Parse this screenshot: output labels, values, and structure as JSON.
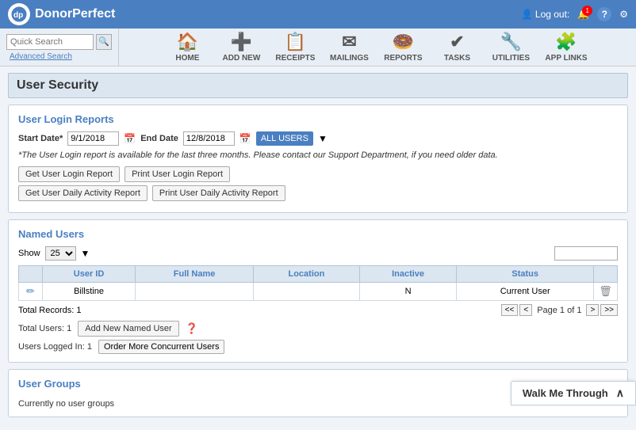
{
  "header": {
    "logo_initials": "dp",
    "logo_alt": "DonorPerfect",
    "logout_label": "Log out:",
    "notification_count": "1"
  },
  "search": {
    "placeholder": "Quick Search",
    "advanced_label": "Advanced Search"
  },
  "nav": {
    "items": [
      {
        "id": "home",
        "label": "HOME",
        "icon": "🏠"
      },
      {
        "id": "add-new",
        "label": "ADD NEW",
        "icon": "➕"
      },
      {
        "id": "receipts",
        "label": "RECEIPTS",
        "icon": "📋"
      },
      {
        "id": "mailings",
        "label": "MAILINGS",
        "icon": "✉"
      },
      {
        "id": "reports",
        "label": "REPORTS",
        "icon": "🍩"
      },
      {
        "id": "tasks",
        "label": "TASKS",
        "icon": "✔"
      },
      {
        "id": "utilities",
        "label": "UTILITIES",
        "icon": "🔧"
      },
      {
        "id": "app-links",
        "label": "APP LINKS",
        "icon": "🧩"
      }
    ]
  },
  "page": {
    "title": "User Security"
  },
  "login_reports": {
    "section_title": "User Login Reports",
    "start_date_label": "Start Date*",
    "start_date_value": "9/1/2018",
    "end_date_label": "End Date",
    "end_date_value": "12/8/2018",
    "all_users_label": "ALL USERS",
    "info_text": "*The User Login report is available for the last three months. Please contact our Support Department, if you need older data.",
    "btn_get_login": "Get User Login Report",
    "btn_print_login": "Print User Login Report",
    "btn_get_daily": "Get User Daily Activity Report",
    "btn_print_daily": "Print User Daily Activity Report"
  },
  "named_users": {
    "section_title": "Named Users",
    "show_label": "Show",
    "show_value": "25",
    "table_headers": [
      "User ID",
      "Full Name",
      "Location",
      "Inactive",
      "Status"
    ],
    "rows": [
      {
        "user_id": "Billstine",
        "full_name": "",
        "location": "",
        "inactive": "N",
        "status": "Current User"
      }
    ],
    "total_records_label": "Total Records: 1",
    "total_users_label": "Total Users: 1",
    "add_named_user_label": "Add New Named User",
    "users_logged_in_label": "Users Logged In: 1",
    "order_concurrent_label": "Order More Concurrent Users",
    "pagination": {
      "first": "<<",
      "prev": "<",
      "page_info": "Page 1 of 1",
      "next": ">",
      "last": ">>"
    }
  },
  "user_groups": {
    "section_title": "User Groups",
    "no_groups_text": "Currently no user groups"
  },
  "walk_me_through": {
    "label": "Walk Me Through",
    "icon": "∧"
  }
}
